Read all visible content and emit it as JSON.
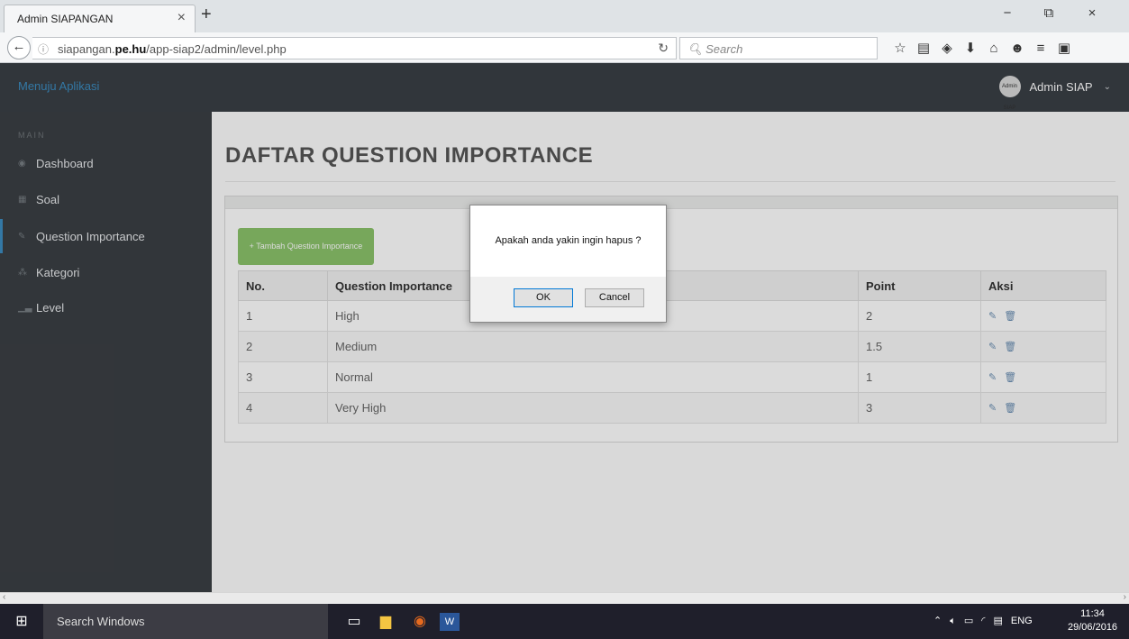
{
  "browser": {
    "tab_title": "Admin SIAPANGAN",
    "tab_close": "×",
    "new_tab": "+",
    "window_controls": [
      "−",
      "⧉",
      "×"
    ],
    "url_prefix": "siapangan.",
    "url_domain": "pe.hu",
    "url_path": "/app-siap2/admin/level.php",
    "search_placeholder": "Search",
    "toolbar_icons": [
      "star-icon",
      "bookmarks-icon",
      "pocket-icon",
      "download-icon",
      "home-icon",
      "emoji-icon",
      "menu-icon",
      "extension-icon"
    ]
  },
  "header": {
    "brand": "Menuju Aplikasi",
    "avatar_text": "Admin SIAP",
    "user_name": "Admin SIAP"
  },
  "sidebar": {
    "section_title": "MAIN",
    "items": [
      {
        "label": "Dashboard",
        "icon": "dashboard-icon"
      },
      {
        "label": "Soal",
        "icon": "grid-icon"
      },
      {
        "label": "Question Importance",
        "icon": "edit-icon",
        "active": true
      },
      {
        "label": "Kategori",
        "icon": "sitemap-icon"
      },
      {
        "label": "Level",
        "icon": "signal-icon"
      }
    ]
  },
  "main": {
    "page_title": "DAFTAR QUESTION IMPORTANCE",
    "add_button": "+ Tambah Question Importance",
    "table": {
      "headers": [
        "No.",
        "Question Importance",
        "Point",
        "Aksi"
      ],
      "rows": [
        {
          "no": "1",
          "name": "High",
          "point": "2"
        },
        {
          "no": "2",
          "name": "Medium",
          "point": "1.5"
        },
        {
          "no": "3",
          "name": "Normal",
          "point": "1"
        },
        {
          "no": "4",
          "name": "Very High",
          "point": "3"
        }
      ]
    }
  },
  "dialog": {
    "message": "Apakah anda yakin ingin hapus ?",
    "ok": "OK",
    "cancel": "Cancel"
  },
  "taskbar": {
    "search": "Search Windows",
    "language": "ENG",
    "time": "11:34",
    "date": "29/06/2016"
  },
  "colors": {
    "accent": "#3c8cc0",
    "header_bg": "#3a3f45",
    "sidebar_bg": "#3b3f44",
    "add_button": "#8bc36a"
  }
}
